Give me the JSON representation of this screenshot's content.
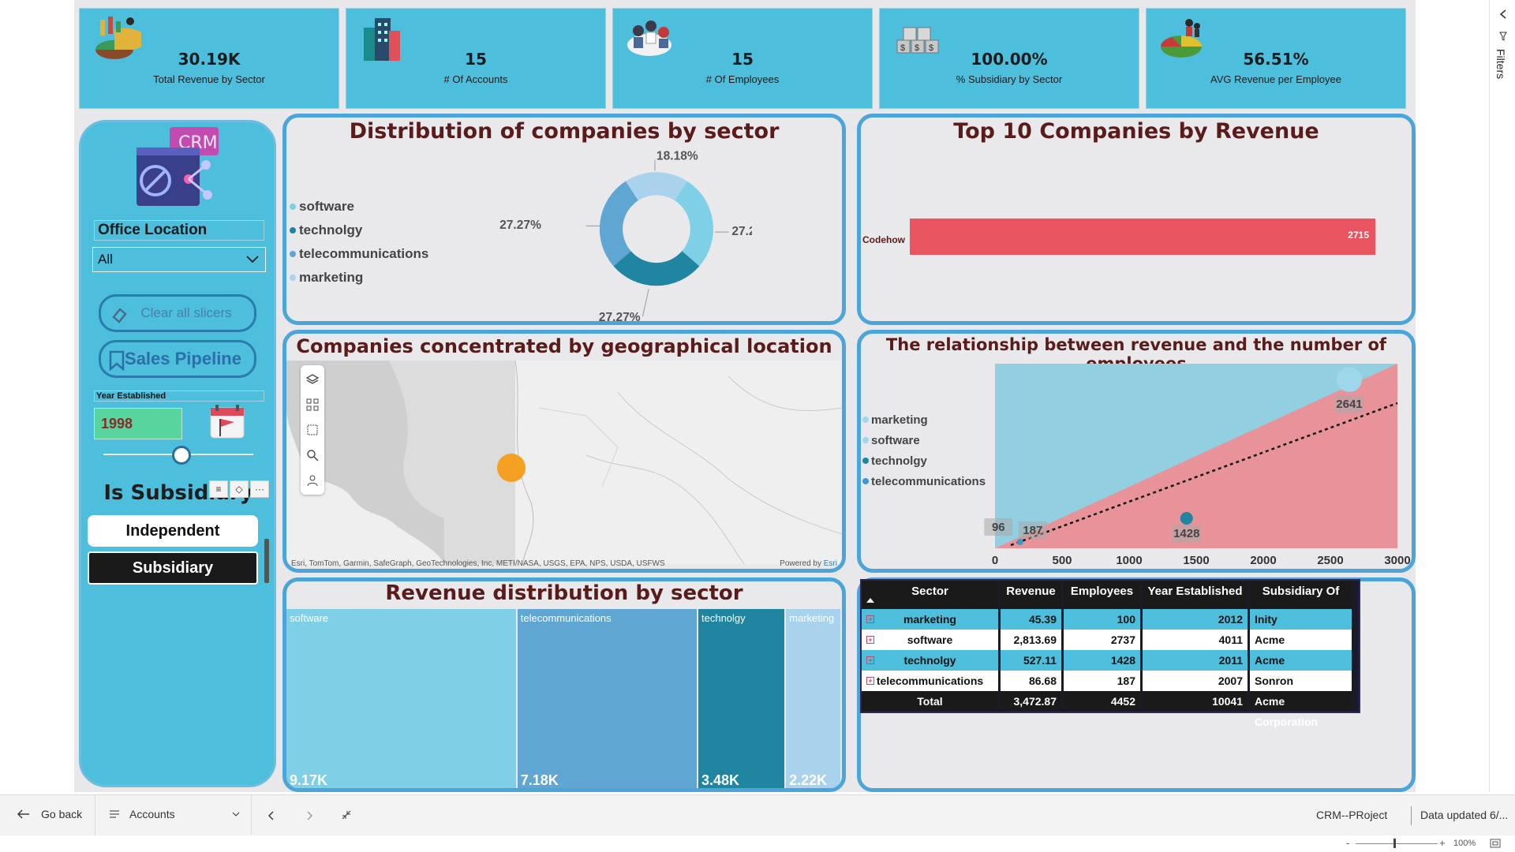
{
  "kpis": [
    {
      "value": "30.19K",
      "label": "Total Revenue by Sector",
      "icon": "pie-chart-icon"
    },
    {
      "value": "15",
      "label": "# Of Accounts",
      "icon": "buildings-icon"
    },
    {
      "value": "15",
      "label": "# Of Employees",
      "icon": "team-icon"
    },
    {
      "value": "100.00%",
      "label": "% Subsidiary by Sector",
      "icon": "dollar-blocks-icon"
    },
    {
      "value": "56.51%",
      "label": "AVG Revenue per Employee",
      "icon": "people-pie-icon"
    }
  ],
  "sidebar": {
    "logo_text": "CRM",
    "office_location_title": "Office Location",
    "office_location_value": "All",
    "clear_button": "Clear all slicers",
    "pipeline_button": "Sales Pipeline",
    "year_title": "Year Established",
    "year_value": "1998",
    "subsidiary_title": "Is Subsidiary",
    "independent_label": "Independent",
    "subsidiary_label": "Subsidiary"
  },
  "donut": {
    "title": "Distribution of companies by sector",
    "legend": [
      "software",
      "technolgy",
      "telecommunications",
      "marketing"
    ],
    "colors": [
      "#7fd0e6",
      "#1f85a1",
      "#5fa6d3",
      "#a9d2ec"
    ],
    "values": [
      27.27,
      27.27,
      27.27,
      18.18
    ],
    "labels": [
      "27.27%",
      "27.27%",
      "27.27%",
      "18.18%"
    ]
  },
  "top10": {
    "title": "Top 10 Companies by Revenue",
    "category": "Codehow",
    "value_label": "2715",
    "value": 2715
  },
  "map": {
    "title": "Companies concentrated by geographical location",
    "attribution": "Esri, TomTom, Garmin, SafeGraph, GeoTechnologies, Inc, METI/NASA, USGS, EPA, NPS, USDA, USFWS",
    "powered": "Powered by",
    "powered_brand": "Esri"
  },
  "scatter": {
    "title": "The relationship between revenue and the number of employees",
    "legend": [
      "marketing",
      "software",
      "technolgy",
      "telecommunications"
    ],
    "legend_colors": [
      "#9fd7ea",
      "#9fd7ea",
      "#1f85a1",
      "#3a9acd"
    ],
    "x_ticks": [
      "0",
      "500",
      "1000",
      "1500",
      "2000",
      "2500",
      "3000"
    ],
    "data_labels": [
      "96",
      "187",
      "1428",
      "2641"
    ]
  },
  "treemap": {
    "title": "Revenue distribution by sector",
    "items": [
      {
        "name": "software",
        "value_label": "9.17K",
        "color": "#7fd0e6"
      },
      {
        "name": "telecommunications",
        "value_label": "7.18K",
        "color": "#5fa6d3"
      },
      {
        "name": "technolgy",
        "value_label": "3.48K",
        "color": "#1f85a1"
      },
      {
        "name": "marketing",
        "value_label": "2.22K",
        "color": "#a9d2ec"
      }
    ]
  },
  "table": {
    "headers": [
      "Sector",
      "Revenue",
      "Employees",
      "Year Established",
      "Subsidiary Of"
    ],
    "rows": [
      [
        "marketing",
        "45.39",
        "100",
        "2012",
        "Inity"
      ],
      [
        "software",
        "2,813.69",
        "2737",
        "4011",
        "Acme Corporation"
      ],
      [
        "technolgy",
        "527.11",
        "1428",
        "2011",
        "Acme Corporation"
      ],
      [
        "telecommunications",
        "86.68",
        "187",
        "2007",
        "Sonron"
      ]
    ],
    "total": [
      "Total",
      "3,472.87",
      "4452",
      "10041",
      "Acme Corporation"
    ]
  },
  "bottombar": {
    "go_back": "Go back",
    "page": "Accounts",
    "report_name": "CRM--PRoject",
    "data_updated": "Data updated 6/..."
  },
  "statusbar": {
    "zoom": "100%"
  },
  "filters_label": "Filters",
  "chart_data": [
    {
      "type": "pie",
      "title": "Distribution of companies by sector",
      "categories": [
        "software",
        "technolgy",
        "telecommunications",
        "marketing"
      ],
      "values": [
        27.27,
        27.27,
        27.27,
        18.18
      ]
    },
    {
      "type": "bar",
      "title": "Top 10 Companies by Revenue",
      "categories": [
        "Codehow"
      ],
      "values": [
        2715
      ]
    },
    {
      "type": "scatter",
      "title": "The relationship between revenue and the number of employees",
      "xlim": [
        0,
        3000
      ],
      "series": [
        {
          "name": "marketing",
          "x": [
            96
          ],
          "y": [
            96
          ]
        },
        {
          "name": "telecommunications",
          "x": [
            187
          ],
          "y": [
            187
          ]
        },
        {
          "name": "technolgy",
          "x": [
            1428
          ],
          "y": [
            1428
          ]
        },
        {
          "name": "software",
          "x": [
            2641
          ],
          "y": [
            2641
          ]
        }
      ]
    },
    {
      "type": "area",
      "title": "Revenue distribution by sector",
      "categories": [
        "software",
        "telecommunications",
        "technolgy",
        "marketing"
      ],
      "values": [
        9170,
        7180,
        3480,
        2220
      ]
    }
  ]
}
